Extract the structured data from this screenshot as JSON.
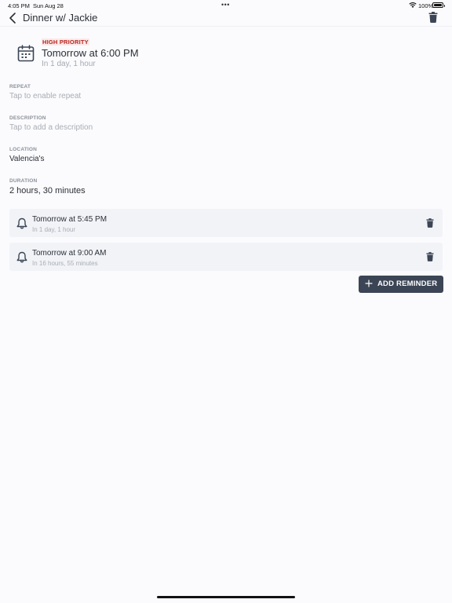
{
  "status_bar": {
    "time": "4:05 PM",
    "date": "Sun Aug 28",
    "dots": "•••",
    "battery": "100%"
  },
  "nav": {
    "title": "Dinner w/ Jackie",
    "icons": {
      "back": "chevron-left-icon",
      "delete": "trash-icon"
    }
  },
  "event": {
    "priority": "HIGH PRIORITY",
    "time": "Tomorrow at 6:00 PM",
    "relative": "In 1 day, 1 hour",
    "icon": "calendar-icon"
  },
  "fields": {
    "repeat": {
      "label": "REPEAT",
      "value": "Tap to enable repeat"
    },
    "description": {
      "label": "DESCRIPTION",
      "value": "Tap to add a description"
    },
    "location": {
      "label": "LOCATION",
      "value": "Valencia's"
    },
    "duration": {
      "label": "DURATION",
      "value": "2 hours, 30 minutes"
    }
  },
  "reminders": [
    {
      "time": "Tomorrow at 5:45 PM",
      "relative": "In 1 day, 1 hour"
    },
    {
      "time": "Tomorrow at 9:00 AM",
      "relative": "In 16 hours, 55 minutes"
    }
  ],
  "add_reminder_label": "ADD REMINDER",
  "colors": {
    "accent": "#3b4555",
    "priority": "#b3261e",
    "priority_bg": "#fde8e8",
    "reminder_bg": "#f1f3f7"
  }
}
